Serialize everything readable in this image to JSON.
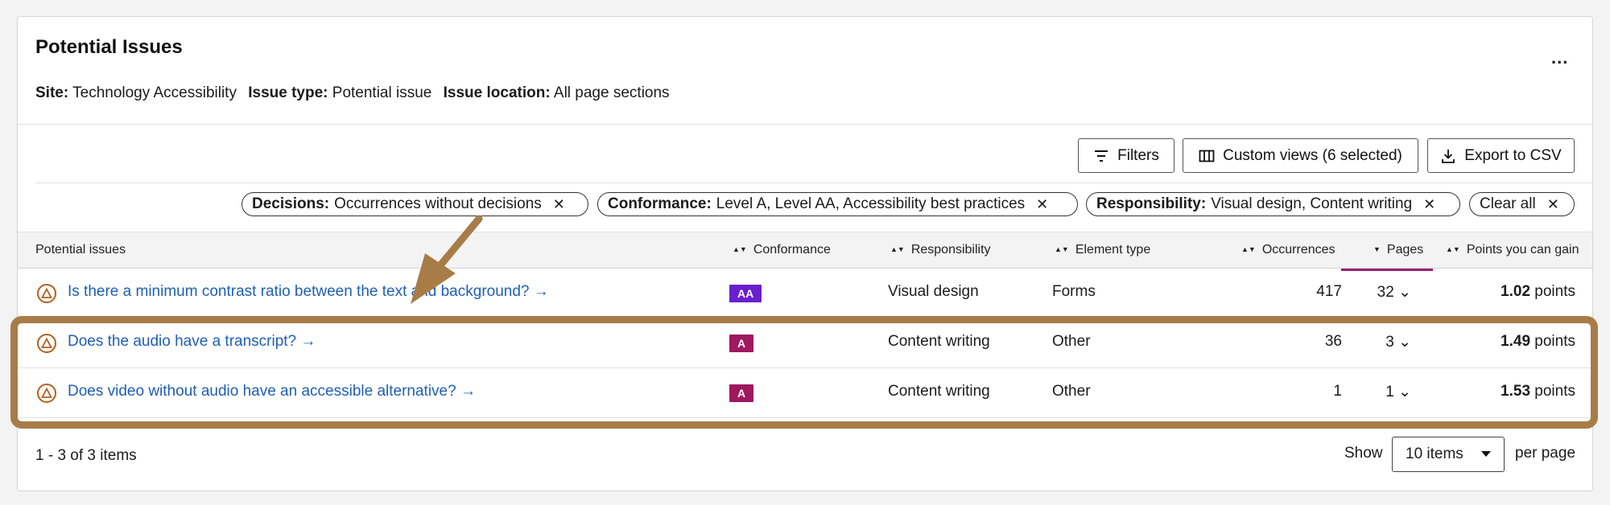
{
  "header": {
    "title": "Potential Issues",
    "more_label": "...",
    "meta": [
      {
        "key": "Site:",
        "value": "Technology Accessibility"
      },
      {
        "key": "Issue type:",
        "value": "Potential issue"
      },
      {
        "key": "Issue location:",
        "value": "All page sections"
      }
    ]
  },
  "toolbar": {
    "filters_label": "Filters",
    "custom_views_label": "Custom views (6 selected)",
    "export_label": "Export to CSV"
  },
  "chips": [
    {
      "key": "Decisions:",
      "value": "Occurrences without decisions"
    },
    {
      "key": "Conformance:",
      "value": "Level A, Level AA, Accessibility best practices"
    },
    {
      "key": "Responsibility:",
      "value": "Visual design, Content writing"
    }
  ],
  "clear_all_label": "Clear all",
  "table": {
    "columns": [
      "Potential issues",
      "Conformance",
      "Responsibility",
      "Element type",
      "Occurrences",
      "Pages",
      "Points you can gain"
    ],
    "rows": [
      {
        "issue": "Is there a minimum contrast ratio between the text and background? →",
        "level": "AA",
        "level_color": "#6a1fcf",
        "responsibility": "Visual design",
        "element_type": "Forms",
        "occurrences": "417",
        "pages": "32",
        "points_value": "1.02",
        "points_unit": "points"
      },
      {
        "issue": "Does the audio have a transcript? →",
        "level": "A",
        "level_color": "#a0185f",
        "responsibility": "Content writing",
        "element_type": "Other",
        "occurrences": "36",
        "pages": "3",
        "points_value": "1.49",
        "points_unit": "points"
      },
      {
        "issue": "Does video without audio have an accessible alternative? →",
        "level": "A",
        "level_color": "#a0185f",
        "responsibility": "Content writing",
        "element_type": "Other",
        "occurrences": "1",
        "pages": "1",
        "points_value": "1.53",
        "points_unit": "points"
      }
    ]
  },
  "footer": {
    "range_text": "1 - 3 of 3 items",
    "show_label": "Show",
    "page_size": "10 items",
    "per_page_label": "per page"
  },
  "colors": {
    "link": "#1f5fb3",
    "sorted_accent": "#9b1f75",
    "annotation": "#a87c47",
    "warning": "#b45f1c"
  }
}
